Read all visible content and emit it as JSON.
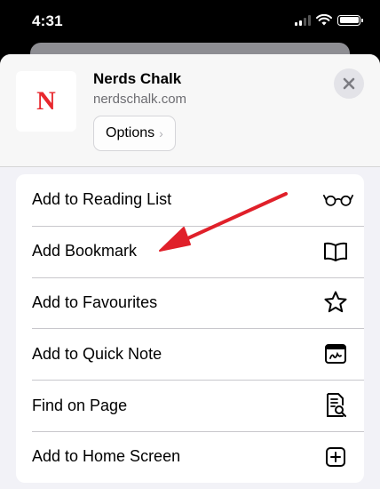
{
  "status_bar": {
    "time": "4:31"
  },
  "share_sheet": {
    "site": {
      "logo_letter": "N",
      "title": "Nerds Chalk",
      "url": "nerdschalk.com",
      "options_label": "Options"
    },
    "close_icon": "xmark-icon",
    "actions": [
      {
        "label": "Add to Reading List",
        "icon": "glasses-icon"
      },
      {
        "label": "Add Bookmark",
        "icon": "book-icon"
      },
      {
        "label": "Add to Favourites",
        "icon": "star-icon"
      },
      {
        "label": "Add to Quick Note",
        "icon": "quick-note-icon"
      },
      {
        "label": "Find on Page",
        "icon": "find-document-icon"
      },
      {
        "label": "Add to Home Screen",
        "icon": "plus-square-icon"
      }
    ]
  },
  "colors": {
    "logo_red": "#e8282e",
    "annotation_arrow": "#e0202a",
    "sheet_background": "#f2f2f7"
  }
}
